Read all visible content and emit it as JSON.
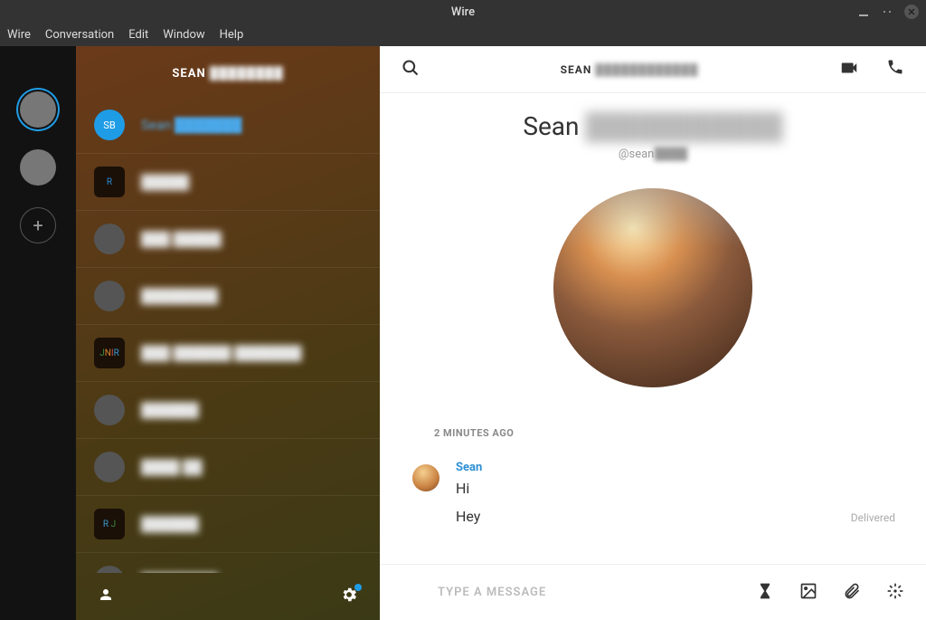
{
  "titlebar": {
    "title": "Wire"
  },
  "menubar": {
    "items": [
      "Wire",
      "Conversation",
      "Edit",
      "Window",
      "Help"
    ]
  },
  "sidebar_header": {
    "prefix": "SEAN",
    "blurred": "████████"
  },
  "conversations": [
    {
      "avatar": "SB",
      "avatar_type": "initials",
      "name": "Sean ███████",
      "active": true
    },
    {
      "avatar": "R",
      "avatar_type": "square-single",
      "name": "█████"
    },
    {
      "avatar": "",
      "avatar_type": "img2",
      "name": "███ █████"
    },
    {
      "avatar": "",
      "avatar_type": "img3",
      "name": "████████"
    },
    {
      "avatar": "JNIR",
      "avatar_type": "square-multi",
      "name": "███ ██████ ███████"
    },
    {
      "avatar": "",
      "avatar_type": "img4",
      "name": "██████"
    },
    {
      "avatar": "",
      "avatar_type": "img5",
      "name": "████ ██"
    },
    {
      "avatar": "RJ",
      "avatar_type": "square-duo",
      "name": "██████"
    },
    {
      "avatar": "",
      "avatar_type": "img6",
      "name": "████████"
    }
  ],
  "main_header": {
    "prefix": "SEAN",
    "blurred": "████████████"
  },
  "profile": {
    "name_prefix": "Sean",
    "name_blurred": "███████████",
    "handle_prefix": "@sean",
    "handle_blurred": "████"
  },
  "timeline": {
    "separator": "2 MINUTES AGO",
    "sender": "Sean",
    "messages": [
      "Hi",
      "Hey"
    ],
    "status": "Delivered"
  },
  "composer": {
    "placeholder": "TYPE A MESSAGE"
  }
}
